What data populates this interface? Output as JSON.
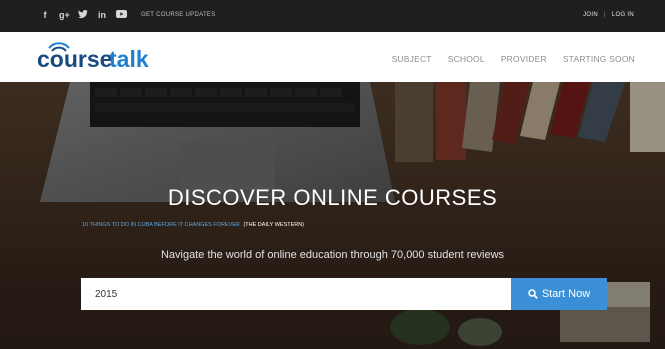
{
  "topbar": {
    "social_icons": [
      {
        "name": "facebook-icon",
        "glyph": "f"
      },
      {
        "name": "google-plus-icon",
        "glyph": "g+"
      },
      {
        "name": "twitter-icon",
        "glyph": "t"
      },
      {
        "name": "linkedin-icon",
        "glyph": "in"
      },
      {
        "name": "youtube-icon",
        "glyph": "▶"
      }
    ],
    "cta_label": "GET COURSE UPDATES",
    "join_label": "JOIN",
    "separator": "|",
    "login_label": "LOG IN"
  },
  "header": {
    "logo_text": "coursetalk",
    "nav": [
      "SUBJECT",
      "SCHOOL",
      "PROVIDER",
      "STARTING SOON"
    ]
  },
  "hero": {
    "title": "DISCOVER ONLINE COURSES",
    "news_link": "10 THINGS TO DO IN CUBA BEFORE IT CHANGES FOREVER",
    "news_source": "(THE DAILY WESTERN)",
    "tagline": "Navigate the world of online education through 70,000 student reviews",
    "search_value": "2015",
    "search_button": "Start Now"
  },
  "colors": {
    "topbar_bg": "#1f1f1f",
    "brand_blue": "#1f7fd1",
    "brand_dark": "#1a4a80",
    "button_blue": "#3b8fd6",
    "link_blue": "#5aa8e6"
  }
}
